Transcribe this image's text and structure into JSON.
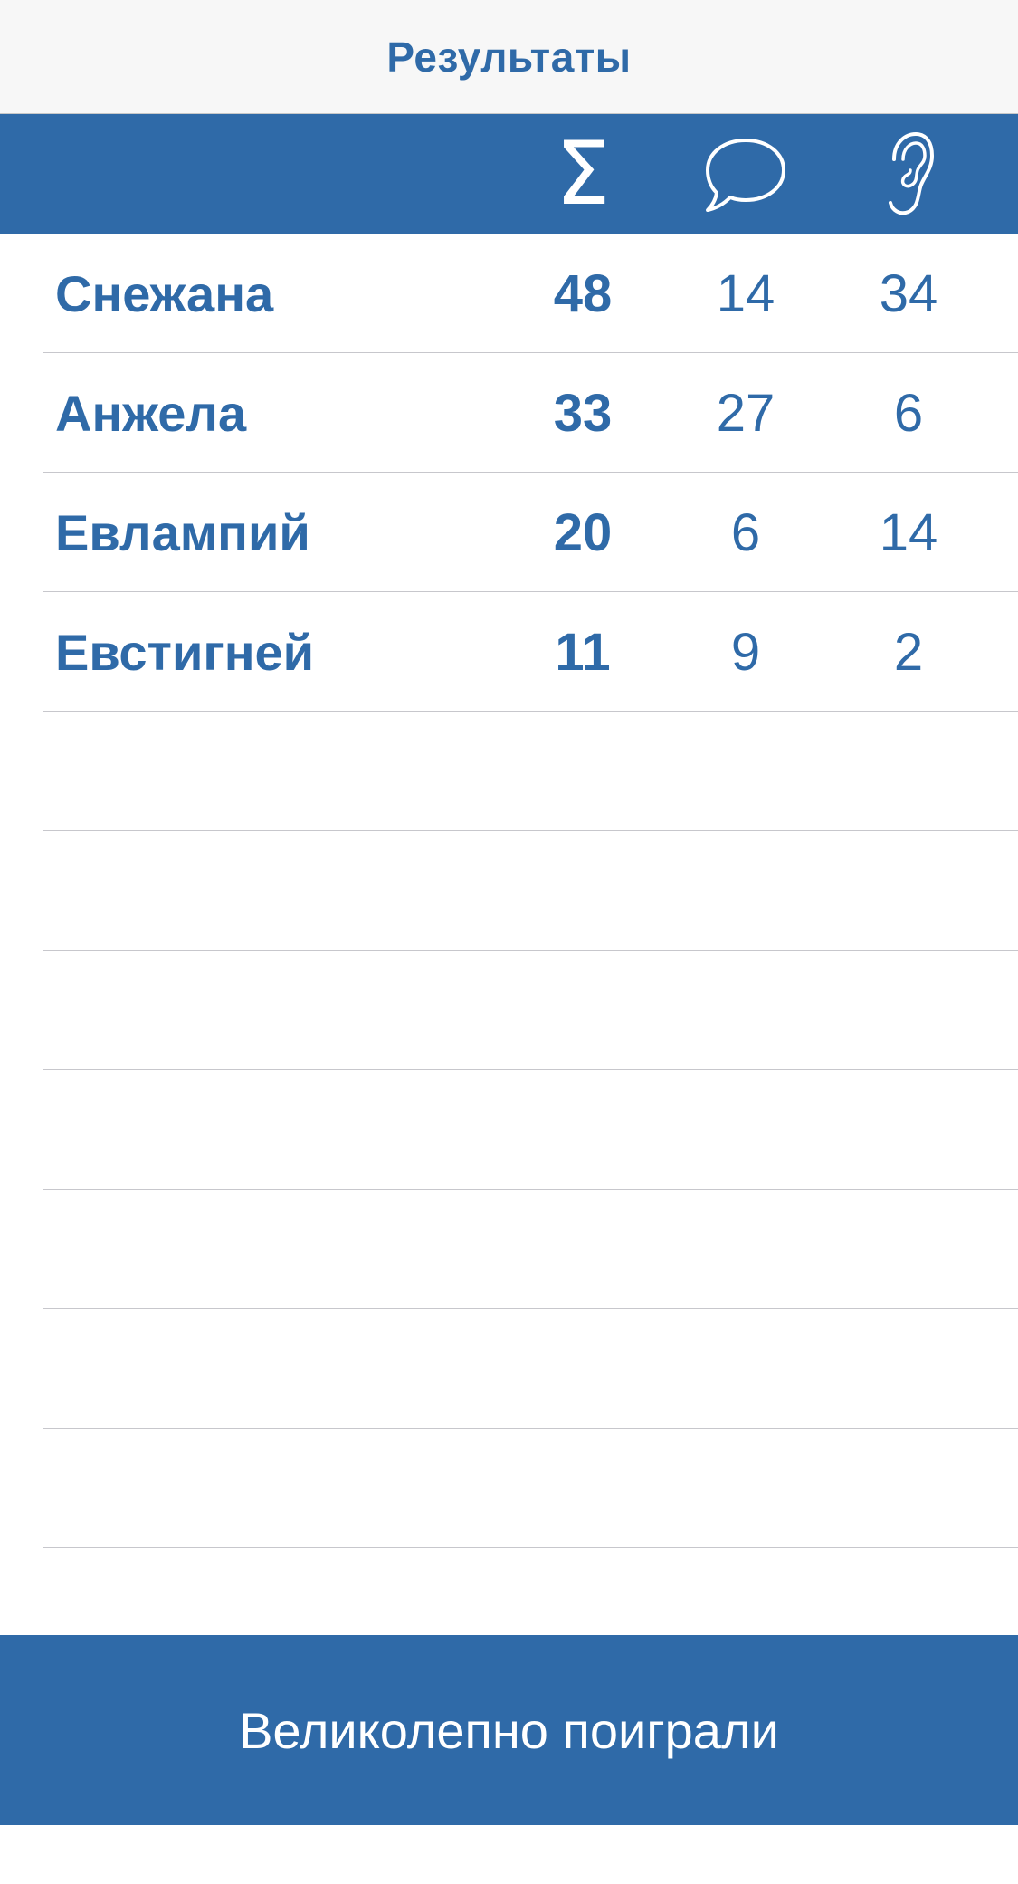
{
  "nav": {
    "title": "Результаты"
  },
  "header": {
    "columns": [
      {
        "key": "total",
        "icon": "sigma-icon",
        "glyph": "Σ"
      },
      {
        "key": "speak",
        "icon": "speech-bubble-icon"
      },
      {
        "key": "listen",
        "icon": "ear-icon"
      }
    ]
  },
  "results": {
    "rows": [
      {
        "name": "Снежана",
        "total": "48",
        "speak": "14",
        "listen": "34"
      },
      {
        "name": "Анжела",
        "total": "33",
        "speak": "27",
        "listen": "6"
      },
      {
        "name": "Евлампий",
        "total": "20",
        "speak": "6",
        "listen": "14"
      },
      {
        "name": "Евстигней",
        "total": "11",
        "speak": "9",
        "listen": "2"
      },
      {
        "name": "",
        "total": "",
        "speak": "",
        "listen": ""
      },
      {
        "name": "",
        "total": "",
        "speak": "",
        "listen": ""
      },
      {
        "name": "",
        "total": "",
        "speak": "",
        "listen": ""
      },
      {
        "name": "",
        "total": "",
        "speak": "",
        "listen": ""
      },
      {
        "name": "",
        "total": "",
        "speak": "",
        "listen": ""
      },
      {
        "name": "",
        "total": "",
        "speak": "",
        "listen": ""
      },
      {
        "name": "",
        "total": "",
        "speak": "",
        "listen": ""
      }
    ]
  },
  "footer": {
    "button_label": "Великолепно поиграли"
  },
  "colors": {
    "accent": "#2f6aa8",
    "nav_background": "#f7f7f7",
    "separator": "#c7c7cc"
  }
}
